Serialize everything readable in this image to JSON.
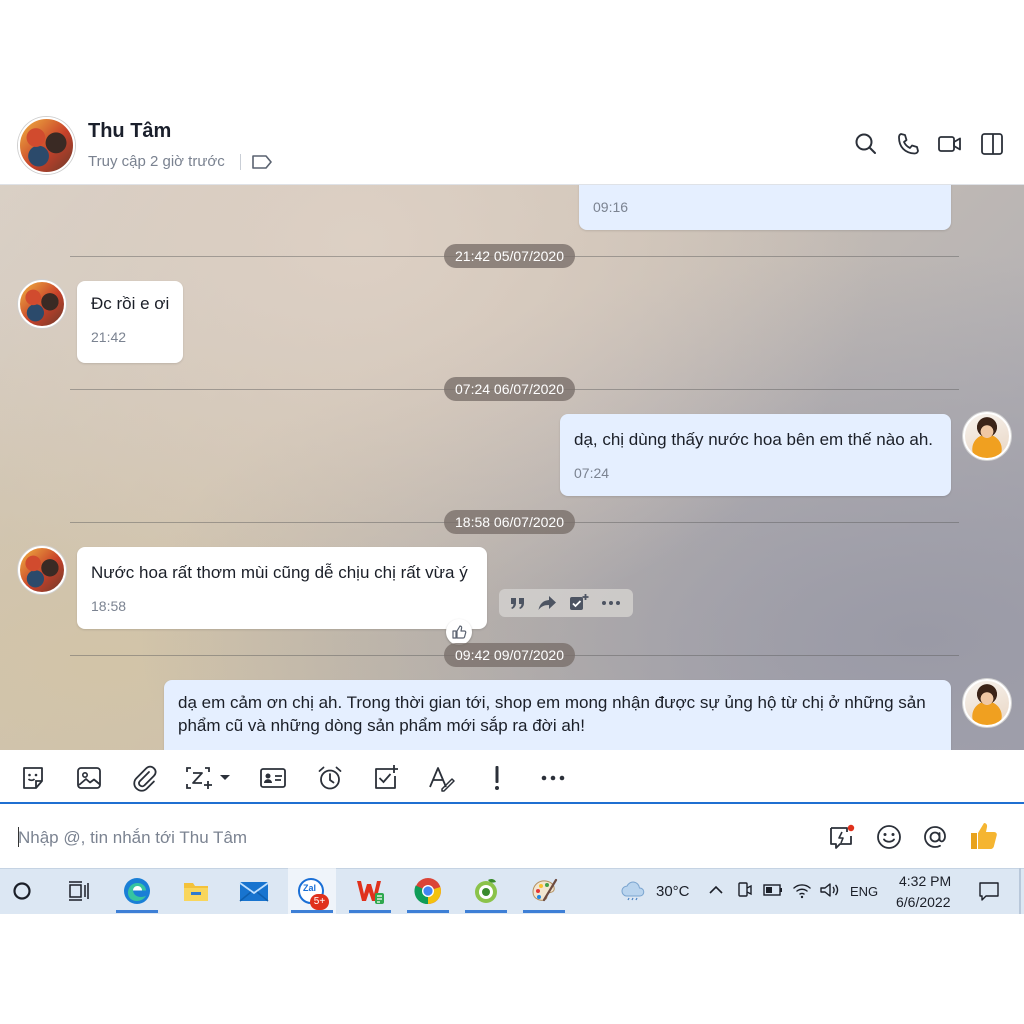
{
  "colors": {
    "accent": "#1f6fd1",
    "outgoing_bubble": "#e5efff",
    "incoming_bubble": "#ffffff",
    "thumbs_up": "#f5b531"
  },
  "header": {
    "name": "Thu Tâm",
    "status": "Truy cập 2 giờ trước",
    "actions": [
      "search-icon",
      "phone-icon",
      "video-call-icon",
      "sidebar-toggle-icon"
    ]
  },
  "messages": [
    {
      "direction": "out",
      "text": "",
      "time": "09:16"
    },
    {
      "divider": "21:42 05/07/2020"
    },
    {
      "direction": "in",
      "text": "Đc rồi e ơi",
      "time": "21:42"
    },
    {
      "divider": "07:24 06/07/2020"
    },
    {
      "direction": "out",
      "text": "dạ, chị dùng thấy nước hoa bên em thế nào ah.",
      "time": "07:24"
    },
    {
      "divider": "18:58 06/07/2020"
    },
    {
      "direction": "in",
      "text": "Nước hoa rất thơm mùi cũng dễ chịu chị rất vừa ý",
      "time": "18:58"
    },
    {
      "divider": "09:42 09/07/2020"
    },
    {
      "direction": "out",
      "lines": [
        "dạ em cảm ơn chị ah. Trong thời gian tới, shop em mong nhận được sự ủng hộ từ chị ở những sản",
        "phẩm cũ và những dòng sản phẩm mới sắp ra đời ah!"
      ]
    }
  ],
  "hover_actions": [
    "quote-icon",
    "forward-icon",
    "add-task-icon",
    "more-icon"
  ],
  "toolbar": [
    "sticker-icon",
    "image-icon",
    "attachment-icon",
    "screenshot-icon",
    "contact-card-icon",
    "reminder-icon",
    "todo-icon",
    "format-text-icon",
    "urgent-icon",
    "more-icon"
  ],
  "input": {
    "placeholder": "Nhập @, tin nhắn tới Thu Tâm",
    "value": ""
  },
  "taskbar": {
    "apps": [
      "cortana-icon",
      "task-view-icon",
      "edge-icon",
      "file-explorer-icon",
      "mail-icon",
      "zalo-icon",
      "wps-office-icon",
      "chrome-icon",
      "coc-coc-icon",
      "paint-icon"
    ],
    "zalo_badge": "5+",
    "zalo_label": "Zal",
    "weather": "30°C",
    "language": "ENG",
    "time": "4:32 PM",
    "date": "6/6/2022"
  }
}
